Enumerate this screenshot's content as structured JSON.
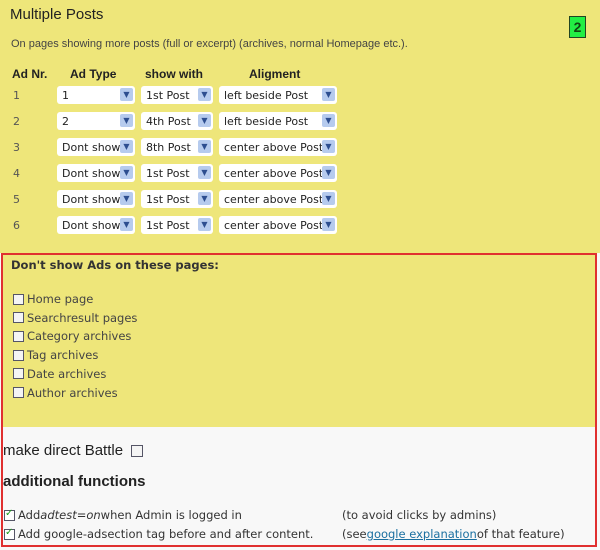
{
  "section": {
    "title": "Multiple Posts",
    "badge": "2",
    "description": "On pages showing more posts (full or excerpt) (archives, normal Homepage etc.)."
  },
  "table": {
    "headers": [
      "Ad Nr.",
      "Ad Type",
      "show with",
      "Aligment"
    ],
    "rows": [
      {
        "nr": "1",
        "ad_type": "1",
        "show_with": "1st Post",
        "alignment": "left beside Post"
      },
      {
        "nr": "2",
        "ad_type": "2",
        "show_with": "4th Post",
        "alignment": "left beside Post"
      },
      {
        "nr": "3",
        "ad_type": "Dont show",
        "show_with": "8th Post",
        "alignment": "center above Post"
      },
      {
        "nr": "4",
        "ad_type": "Dont show",
        "show_with": "1st Post",
        "alignment": "center above Post"
      },
      {
        "nr": "5",
        "ad_type": "Dont show",
        "show_with": "1st Post",
        "alignment": "center above Post"
      },
      {
        "nr": "6",
        "ad_type": "Dont show",
        "show_with": "1st Post",
        "alignment": "center above Post"
      }
    ]
  },
  "exclusions": {
    "heading": "Don't show Ads on these pages:",
    "items": [
      {
        "label": "Home page",
        "checked": false
      },
      {
        "label": "Searchresult pages",
        "checked": false
      },
      {
        "label": "Category archives",
        "checked": false
      },
      {
        "label": "Tag archives",
        "checked": false
      },
      {
        "label": "Date archives",
        "checked": false
      },
      {
        "label": "Author archives",
        "checked": false
      }
    ]
  },
  "battle": {
    "label": "make direct Battle",
    "checked": false
  },
  "additional": {
    "heading": "additional functions",
    "options": [
      {
        "prefix": "Add ",
        "em": "adtest=on",
        "suffix": " when Admin is logged in",
        "note": "(to avoid clicks by admins)",
        "checked": true
      },
      {
        "prefix": "Add google-adsection tag before and after content.",
        "note_pre": "(see ",
        "link": "google explanation",
        "note_post": " of that feature)",
        "checked": true
      }
    ]
  },
  "colors": {
    "panel_bg": "#eee67a",
    "border_red": "#e03030",
    "badge_green": "#22ee44",
    "link": "#1a6fa0"
  }
}
